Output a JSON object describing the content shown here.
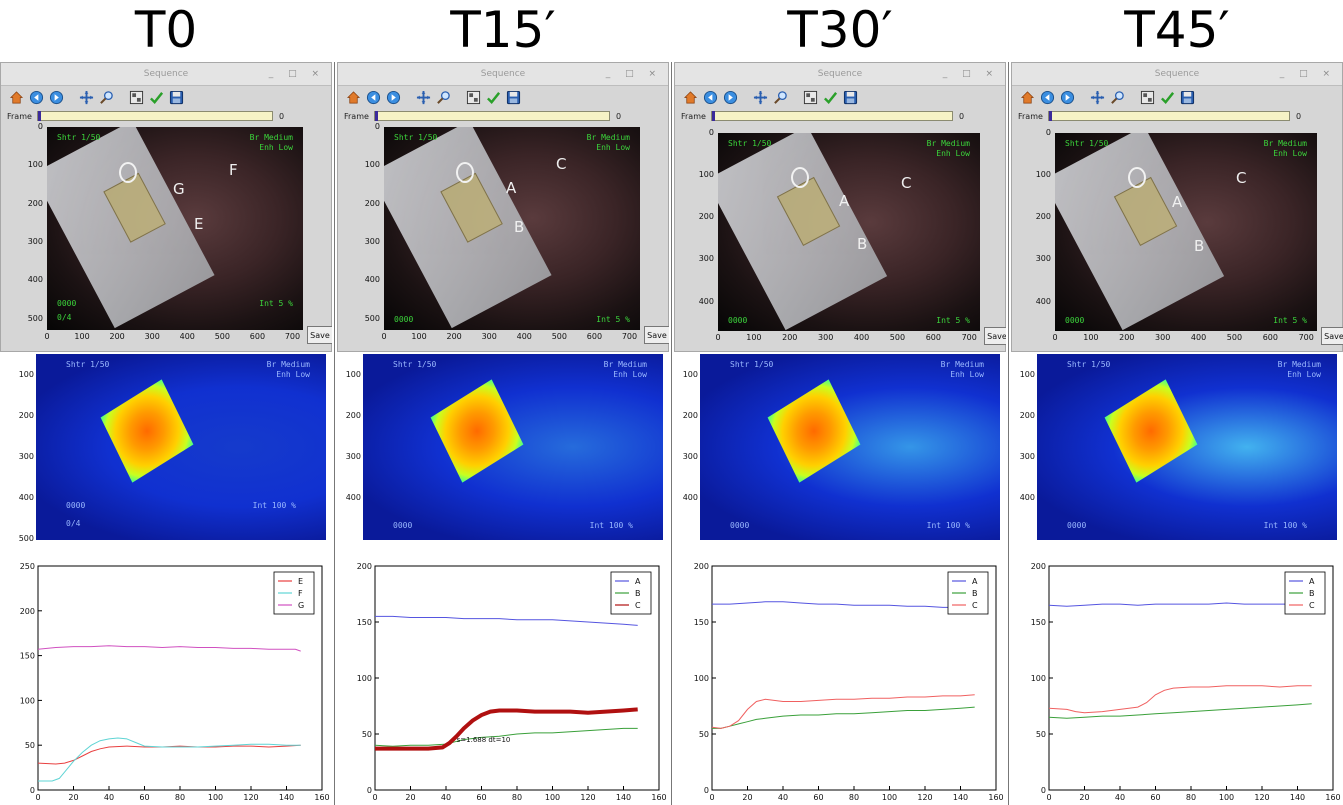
{
  "headers": [
    "T0",
    "T15′",
    "T30′",
    "T45′"
  ],
  "window": {
    "title": "Sequence",
    "frame_label": "Frame",
    "frame_value": "0",
    "save_label": "Save"
  },
  "toolbar_icons": [
    "home-icon",
    "back-icon",
    "forward-icon",
    "pan-icon",
    "zoom-icon",
    "subplots-icon",
    "check-icon",
    "save-icon"
  ],
  "overlay": {
    "shutter": "Shtr 1/50",
    "brightness": "Br Medium",
    "enhance": "Enh Low",
    "counter": "0000",
    "intensity_low": "Int  5 %",
    "intensity_high": "Int 100 %",
    "fraction": "0/4"
  },
  "panels": [
    {
      "photo_yticks": [
        "0",
        "100",
        "200",
        "300",
        "400",
        "500"
      ],
      "photo_xticks": [
        "0",
        "100",
        "200",
        "300",
        "400",
        "500",
        "600",
        "700"
      ],
      "point_labels": [
        "G",
        "F",
        "E"
      ],
      "fluor_yticks": [
        "100",
        "200",
        "300",
        "400",
        "500"
      ]
    },
    {
      "photo_yticks": [
        "0",
        "100",
        "200",
        "300",
        "400",
        "500"
      ],
      "photo_xticks": [
        "0",
        "100",
        "200",
        "300",
        "400",
        "500",
        "600",
        "700"
      ],
      "point_labels": [
        "A",
        "C",
        "B"
      ],
      "fluor_yticks": [
        "100",
        "200",
        "300",
        "400"
      ]
    },
    {
      "photo_yticks": [
        "0",
        "100",
        "200",
        "300",
        "400"
      ],
      "photo_xticks": [
        "0",
        "100",
        "200",
        "300",
        "400",
        "500",
        "600",
        "700"
      ],
      "point_labels": [
        "A",
        "C",
        "B"
      ],
      "fluor_yticks": [
        "100",
        "200",
        "300",
        "400"
      ]
    },
    {
      "photo_yticks": [
        "0",
        "100",
        "200",
        "300",
        "400"
      ],
      "photo_xticks": [
        "0",
        "100",
        "200",
        "300",
        "400",
        "500",
        "600",
        "700"
      ],
      "point_labels": [
        "A",
        "C",
        "B"
      ],
      "fluor_yticks": [
        "100",
        "200",
        "300",
        "400"
      ]
    }
  ],
  "chart_data": [
    {
      "type": "line",
      "title": "",
      "xlabel": "",
      "ylabel": "",
      "xlim": [
        0,
        160
      ],
      "ylim": [
        0,
        250
      ],
      "xticks": [
        "0",
        "20",
        "40",
        "60",
        "80",
        "100",
        "120",
        "140",
        "160"
      ],
      "yticks": [
        "0",
        "50",
        "100",
        "150",
        "200",
        "250"
      ],
      "legend": "top-right",
      "series": [
        {
          "name": "E",
          "color": "#e84040",
          "x": [
            0,
            10,
            15,
            20,
            25,
            30,
            35,
            40,
            50,
            60,
            70,
            80,
            90,
            100,
            110,
            120,
            130,
            140,
            148
          ],
          "y": [
            30,
            29,
            30,
            33,
            38,
            43,
            46,
            48,
            49,
            48,
            48,
            49,
            48,
            48,
            49,
            49,
            48,
            49,
            50
          ]
        },
        {
          "name": "F",
          "color": "#5fd4d4",
          "x": [
            0,
            8,
            12,
            15,
            20,
            25,
            30,
            35,
            40,
            45,
            50,
            55,
            60,
            70,
            80,
            90,
            100,
            110,
            120,
            130,
            140,
            148
          ],
          "y": [
            10,
            10,
            13,
            20,
            32,
            42,
            50,
            55,
            57,
            58,
            57,
            53,
            49,
            48,
            48,
            48,
            49,
            50,
            51,
            51,
            50,
            50
          ]
        },
        {
          "name": "G",
          "color": "#d050c0",
          "x": [
            0,
            10,
            20,
            30,
            40,
            50,
            60,
            70,
            80,
            90,
            100,
            110,
            120,
            130,
            140,
            145,
            148
          ],
          "y": [
            157,
            159,
            160,
            160,
            161,
            160,
            160,
            159,
            160,
            159,
            159,
            158,
            158,
            157,
            157,
            157,
            155
          ]
        }
      ]
    },
    {
      "type": "line",
      "title": "",
      "xlabel": "",
      "ylabel": "",
      "xlim": [
        0,
        160
      ],
      "ylim": [
        0,
        200
      ],
      "xticks": [
        "0",
        "20",
        "40",
        "60",
        "80",
        "100",
        "120",
        "140",
        "160"
      ],
      "yticks": [
        "0",
        "50",
        "100",
        "150",
        "200"
      ],
      "legend": "top-right",
      "annotation": "s=1.688 dt=10",
      "series": [
        {
          "name": "A",
          "color": "#5555e0",
          "x": [
            0,
            10,
            20,
            30,
            40,
            50,
            60,
            70,
            80,
            90,
            100,
            110,
            120,
            130,
            140,
            148
          ],
          "y": [
            155,
            155,
            154,
            154,
            154,
            153,
            153,
            153,
            152,
            152,
            152,
            151,
            150,
            149,
            148,
            147
          ]
        },
        {
          "name": "B",
          "color": "#3aa03a",
          "x": [
            0,
            10,
            20,
            30,
            40,
            45,
            50,
            60,
            70,
            80,
            90,
            100,
            110,
            120,
            130,
            140,
            148
          ],
          "y": [
            40,
            39,
            40,
            40,
            41,
            43,
            45,
            47,
            48,
            50,
            51,
            51,
            52,
            53,
            54,
            55,
            55
          ]
        },
        {
          "name": "C",
          "color": "#b01010",
          "x": [
            0,
            10,
            20,
            30,
            38,
            42,
            46,
            50,
            55,
            60,
            65,
            70,
            80,
            90,
            100,
            110,
            120,
            130,
            140,
            148
          ],
          "y": [
            37,
            37,
            37,
            37,
            38,
            42,
            48,
            55,
            62,
            67,
            70,
            71,
            71,
            70,
            70,
            70,
            69,
            70,
            71,
            72
          ]
        }
      ]
    },
    {
      "type": "line",
      "title": "",
      "xlabel": "",
      "ylabel": "",
      "xlim": [
        0,
        160
      ],
      "ylim": [
        0,
        200
      ],
      "xticks": [
        "0",
        "20",
        "40",
        "60",
        "80",
        "100",
        "120",
        "140",
        "160"
      ],
      "yticks": [
        "0",
        "50",
        "100",
        "150",
        "200"
      ],
      "legend": "top-right",
      "series": [
        {
          "name": "A",
          "color": "#5555e0",
          "x": [
            0,
            10,
            20,
            30,
            40,
            50,
            60,
            70,
            80,
            90,
            100,
            110,
            120,
            130,
            140,
            148
          ],
          "y": [
            166,
            166,
            167,
            168,
            168,
            167,
            166,
            166,
            165,
            165,
            165,
            164,
            164,
            163,
            163,
            162
          ]
        },
        {
          "name": "B",
          "color": "#3aa03a",
          "x": [
            0,
            5,
            10,
            15,
            20,
            25,
            30,
            40,
            50,
            60,
            70,
            80,
            90,
            100,
            110,
            120,
            130,
            140,
            148
          ],
          "y": [
            55,
            55,
            57,
            59,
            61,
            63,
            64,
            66,
            67,
            67,
            68,
            68,
            69,
            70,
            71,
            71,
            72,
            73,
            74
          ]
        },
        {
          "name": "C",
          "color": "#f06060",
          "x": [
            0,
            5,
            10,
            15,
            20,
            25,
            30,
            35,
            40,
            50,
            60,
            70,
            80,
            90,
            100,
            110,
            120,
            130,
            140,
            148
          ],
          "y": [
            56,
            55,
            57,
            62,
            72,
            79,
            81,
            80,
            79,
            79,
            80,
            81,
            81,
            82,
            82,
            83,
            83,
            84,
            84,
            85
          ]
        }
      ]
    },
    {
      "type": "line",
      "title": "",
      "xlabel": "",
      "ylabel": "",
      "xlim": [
        0,
        160
      ],
      "ylim": [
        0,
        200
      ],
      "xticks": [
        "0",
        "20",
        "40",
        "60",
        "80",
        "100",
        "120",
        "140",
        "160"
      ],
      "yticks": [
        "0",
        "50",
        "100",
        "150",
        "200"
      ],
      "legend": "top-right",
      "series": [
        {
          "name": "A",
          "color": "#5555e0",
          "x": [
            0,
            10,
            20,
            30,
            40,
            50,
            60,
            70,
            80,
            90,
            100,
            110,
            120,
            130,
            140,
            148
          ],
          "y": [
            165,
            164,
            165,
            166,
            166,
            165,
            166,
            166,
            166,
            166,
            167,
            166,
            166,
            166,
            166,
            165
          ]
        },
        {
          "name": "B",
          "color": "#3aa03a",
          "x": [
            0,
            10,
            20,
            30,
            40,
            50,
            60,
            70,
            80,
            90,
            100,
            110,
            120,
            130,
            140,
            148
          ],
          "y": [
            65,
            64,
            65,
            66,
            66,
            67,
            68,
            69,
            70,
            71,
            72,
            73,
            74,
            75,
            76,
            77
          ]
        },
        {
          "name": "C",
          "color": "#f06060",
          "x": [
            0,
            10,
            15,
            20,
            30,
            40,
            50,
            55,
            60,
            65,
            70,
            80,
            90,
            100,
            110,
            120,
            130,
            140,
            148
          ],
          "y": [
            73,
            72,
            70,
            69,
            70,
            72,
            74,
            78,
            85,
            89,
            91,
            92,
            92,
            93,
            93,
            93,
            92,
            93,
            93
          ]
        }
      ]
    }
  ]
}
